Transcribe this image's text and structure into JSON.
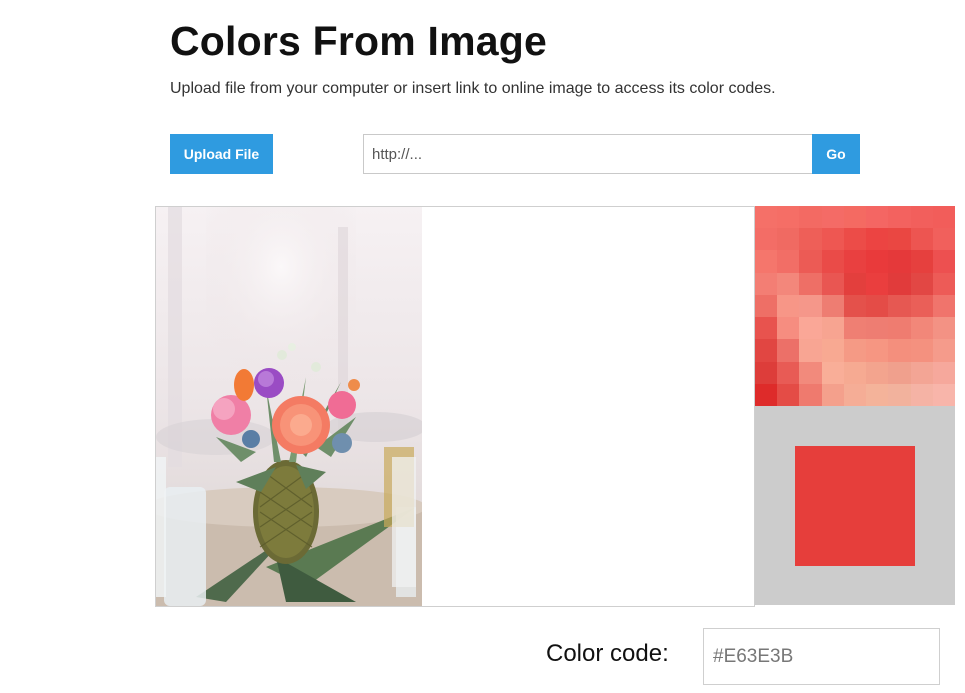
{
  "header": {
    "title": "Colors From Image",
    "subtitle": "Upload file from your computer or insert link to online image to access its color codes."
  },
  "controls": {
    "upload_label": "Upload File",
    "url_placeholder": "http://...",
    "go_label": "Go"
  },
  "picker": {
    "selected_color": "#E63E3B",
    "zoom_pixels": [
      "#f57068",
      "#f56e66",
      "#f36a63",
      "#f46b66",
      "#f46a62",
      "#f46663",
      "#f3625f",
      "#f25f5c",
      "#f25d5a",
      "#f36d66",
      "#f06a62",
      "#ee5f58",
      "#ee5752",
      "#ec4c48",
      "#ec4442",
      "#ea4742",
      "#ed5551",
      "#f1605c",
      "#f5766c",
      "#f26e66",
      "#ec5b55",
      "#ea4b48",
      "#e94040",
      "#e93a3b",
      "#e5393a",
      "#e6403e",
      "#ed5050",
      "#f37e74",
      "#f3877b",
      "#ee6f66",
      "#e95652",
      "#e33f3d",
      "#ea3e3e",
      "#e13b3b",
      "#e24744",
      "#ed5b57",
      "#ee6f66",
      "#f79687",
      "#f5978a",
      "#ee7d72",
      "#e4514b",
      "#e44c47",
      "#e65852",
      "#ea5f58",
      "#f0746c",
      "#e8534e",
      "#f68d80",
      "#faa797",
      "#f7a491",
      "#ef7f73",
      "#ee7d72",
      "#ef7c70",
      "#f28779",
      "#f39284",
      "#e14642",
      "#ec7068",
      "#f8a593",
      "#f8a992",
      "#f59a85",
      "#f69682",
      "#f48f7d",
      "#f4917f",
      "#f59b8b",
      "#dd3d3a",
      "#e85b55",
      "#f28a7c",
      "#f9ae98",
      "#f6aa92",
      "#f3a48e",
      "#f0a08d",
      "#f3a595",
      "#f6a89c",
      "#de2b2a",
      "#e44c46",
      "#ef7a6e",
      "#f4a08c",
      "#f5ad96",
      "#f4b39a",
      "#f2b29d",
      "#f5b3a5",
      "#f8b5aa"
    ]
  },
  "result": {
    "code_label": "Color code:",
    "code_value": "#E63E3B"
  }
}
